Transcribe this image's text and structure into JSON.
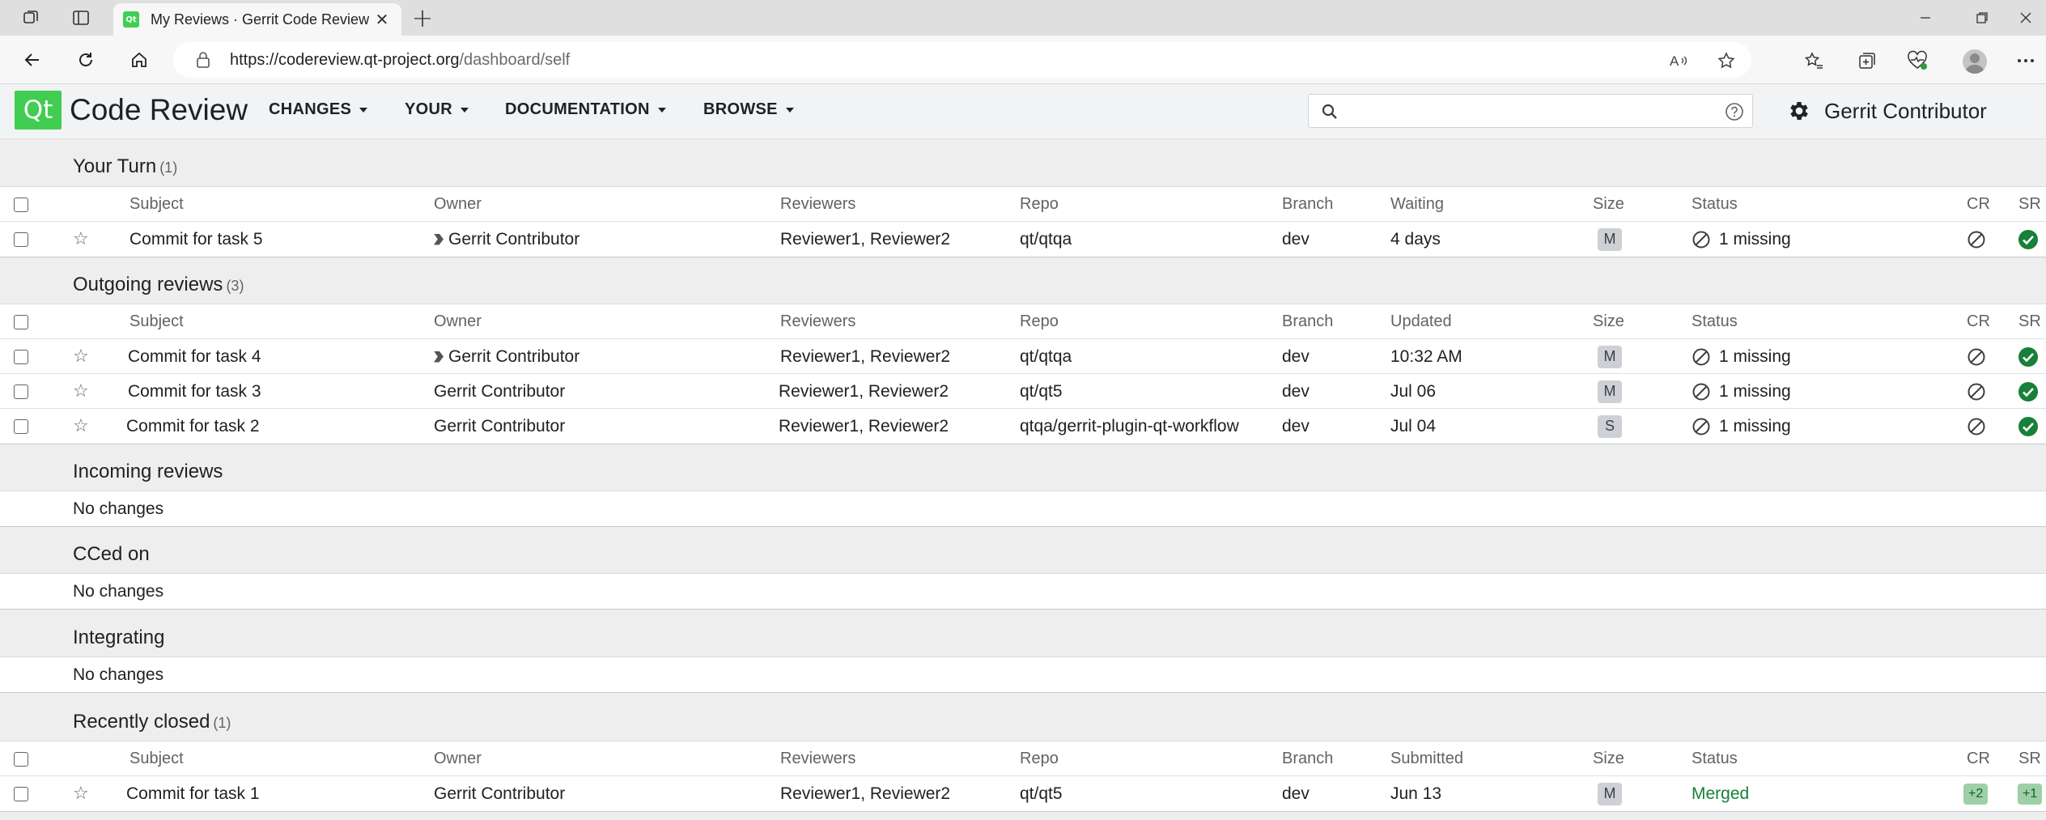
{
  "browser": {
    "tab_title": "My Reviews · Gerrit Code Review",
    "favicon_text": "Qt",
    "tab_close": "✕",
    "new_tab": "+",
    "url_host": "https://codereview.qt-project.org",
    "url_path": "/dashboard/self"
  },
  "header": {
    "logo_text": "Qt",
    "brand": "Code Review",
    "menus": [
      "CHANGES",
      "YOUR",
      "DOCUMENTATION",
      "BROWSE"
    ],
    "search_value": "",
    "user_name": "Gerrit Contributor"
  },
  "sections": [
    {
      "title": "Your Turn",
      "count": "(1)",
      "time_header": "Waiting",
      "rows": [
        {
          "subject": "Commit for task 5",
          "owner": "Gerrit Contributor",
          "owner_marker": true,
          "reviewers": "Reviewer1, Reviewer2",
          "repo": "qt/qtqa",
          "branch": "dev",
          "time": "4 days",
          "size": "M",
          "status": "1 missing"
        }
      ]
    },
    {
      "title": "Outgoing reviews",
      "count": "(3)",
      "time_header": "Updated",
      "rows": [
        {
          "subject": "Commit for task 4",
          "owner": "Gerrit Contributor",
          "owner_marker": true,
          "reviewers": "Reviewer1, Reviewer2",
          "repo": "qt/qtqa",
          "branch": "dev",
          "time": "10:32 AM",
          "size": "M",
          "status": "1 missing"
        },
        {
          "subject": "Commit for task 3",
          "owner": "Gerrit Contributor",
          "owner_marker": false,
          "reviewers": "Reviewer1, Reviewer2",
          "repo": "qt/qt5",
          "branch": "dev",
          "time": "Jul 06",
          "size": "M",
          "status": "1 missing"
        },
        {
          "subject": "Commit for task 2",
          "owner": "Gerrit Contributor",
          "owner_marker": false,
          "reviewers": "Reviewer1, Reviewer2",
          "repo": "qtqa/gerrit-plugin-qt-workflow",
          "branch": "dev",
          "time": "Jul 04",
          "size": "S",
          "status": "1 missing"
        }
      ]
    },
    {
      "title": "Incoming reviews",
      "empty_text": "No changes"
    },
    {
      "title": "CCed on",
      "empty_text": "No changes"
    },
    {
      "title": "Integrating",
      "empty_text": "No changes"
    },
    {
      "title": "Recently closed",
      "count": "(1)",
      "time_header": "Submitted",
      "rows": [
        {
          "subject": "Commit for task 1",
          "owner": "Gerrit Contributor",
          "owner_marker": false,
          "reviewers": "Reviewer1, Reviewer2",
          "repo": "qt/qt5",
          "branch": "dev",
          "time": "Jun 13",
          "size": "M",
          "status": "Merged",
          "cr": "+2",
          "sr": "+1"
        }
      ]
    }
  ],
  "columns": {
    "subject": "Subject",
    "owner": "Owner",
    "reviewers": "Reviewers",
    "repo": "Repo",
    "branch": "Branch",
    "size": "Size",
    "status": "Status",
    "cr": "CR",
    "sr": "SR"
  },
  "colors": {
    "qt_green": "#41cd52",
    "approved_green": "#188038",
    "header_bg": "#f1f3f4"
  }
}
